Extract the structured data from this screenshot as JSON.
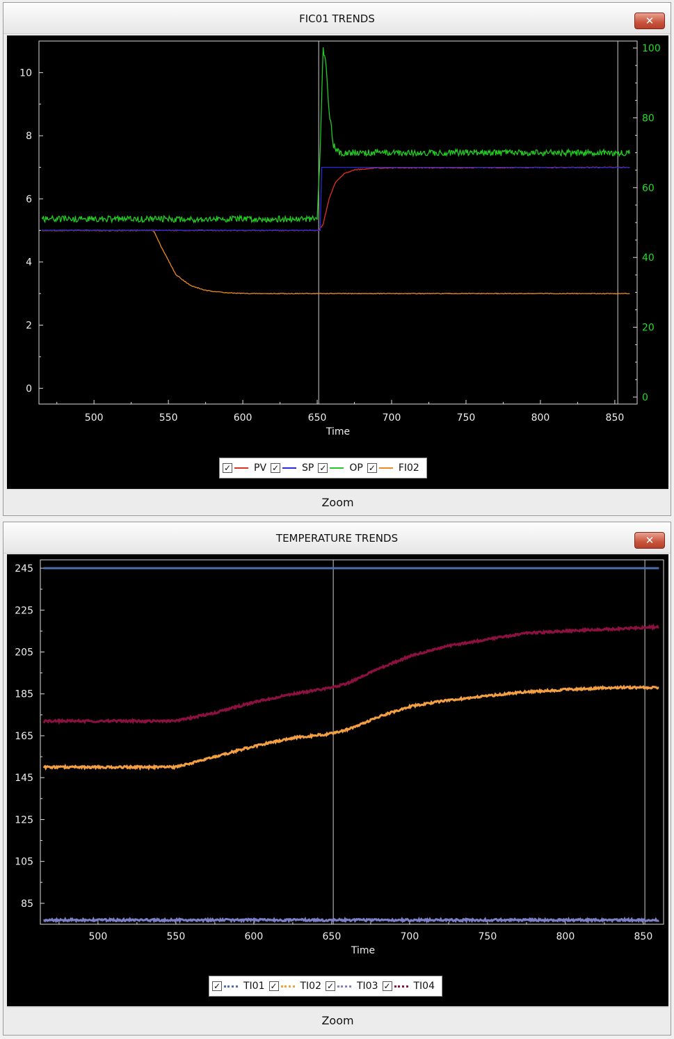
{
  "fic": {
    "title": "FIC01  TRENDS",
    "close_glyph": "✕",
    "xlabel": "Time",
    "left_ticks": [
      "0",
      "2",
      "4",
      "6",
      "8",
      "10"
    ],
    "right_ticks": [
      "0",
      "20",
      "40",
      "60",
      "80",
      "100"
    ],
    "x_ticks": [
      "500",
      "550",
      "600",
      "650",
      "700",
      "750",
      "800",
      "850"
    ],
    "legend": [
      {
        "label": "PV",
        "color": "#e0301e"
      },
      {
        "label": "SP",
        "color": "#2a2ae0"
      },
      {
        "label": "OP",
        "color": "#22cc22"
      },
      {
        "label": "FI02",
        "color": "#ee8822"
      }
    ],
    "right_axis_color": "#22dd22",
    "zoom_label": "Zoom"
  },
  "temp": {
    "title": "TEMPERATURE  TRENDS",
    "close_glyph": "✕",
    "xlabel": "Time",
    "left_ticks": [
      "85",
      "105",
      "125",
      "145",
      "165",
      "185",
      "205",
      "225",
      "245"
    ],
    "x_ticks": [
      "500",
      "550",
      "600",
      "650",
      "700",
      "750",
      "800",
      "850"
    ],
    "legend": [
      {
        "label": "TI01",
        "color": "#4a6fb0"
      },
      {
        "label": "TI02",
        "color": "#f5a040"
      },
      {
        "label": "TI03",
        "color": "#8080c8"
      },
      {
        "label": "TI04",
        "color": "#8c1040"
      }
    ],
    "zoom_label": "Zoom"
  },
  "chart_data": [
    {
      "type": "line",
      "title": "FIC01  TRENDS",
      "xlabel": "Time",
      "ylabel": "",
      "xlim": [
        463,
        865
      ],
      "ylim_left": [
        -0.5,
        11
      ],
      "ylim_right": [
        -2,
        102
      ],
      "cursor_x": [
        651,
        852
      ],
      "series": [
        {
          "name": "PV",
          "axis": "left",
          "x": [
            465,
            651,
            654,
            658,
            662,
            668,
            675,
            690,
            860
          ],
          "y": [
            5.0,
            5.0,
            5.2,
            6.0,
            6.5,
            6.8,
            6.92,
            6.98,
            7.0
          ]
        },
        {
          "name": "SP",
          "axis": "left",
          "x": [
            465,
            652,
            653,
            860
          ],
          "y": [
            5.0,
            5.0,
            7.0,
            7.0
          ]
        },
        {
          "name": "OP",
          "axis": "right",
          "x": [
            465,
            650,
            652,
            654,
            656,
            658,
            661,
            665,
            670,
            680,
            860
          ],
          "y": [
            51,
            51,
            70,
            100,
            95,
            82,
            72,
            70,
            70,
            70,
            70
          ]
        },
        {
          "name": "FI02",
          "axis": "left",
          "x": [
            465,
            540,
            545,
            555,
            565,
            575,
            590,
            605,
            860
          ],
          "y": [
            5.0,
            5.0,
            4.5,
            3.6,
            3.25,
            3.1,
            3.02,
            3.0,
            3.0
          ]
        }
      ],
      "legend_position": "bottom-center"
    },
    {
      "type": "line",
      "title": "TEMPERATURE  TRENDS",
      "xlabel": "Time",
      "ylabel": "",
      "xlim": [
        463,
        863
      ],
      "ylim": [
        75,
        249
      ],
      "cursor_x": [
        651,
        851
      ],
      "series": [
        {
          "name": "TI01",
          "x": [
            465,
            860
          ],
          "y": [
            245,
            245
          ]
        },
        {
          "name": "TI02",
          "x": [
            465,
            550,
            575,
            600,
            625,
            650,
            660,
            680,
            700,
            725,
            750,
            775,
            800,
            830,
            860
          ],
          "y": [
            150,
            150,
            155,
            160,
            164,
            166,
            168,
            174,
            179,
            182,
            184,
            186,
            187,
            188,
            188
          ]
        },
        {
          "name": "TI03",
          "x": [
            465,
            860
          ],
          "y": [
            77,
            77
          ]
        },
        {
          "name": "TI04",
          "x": [
            465,
            550,
            575,
            600,
            625,
            650,
            660,
            680,
            700,
            725,
            750,
            775,
            800,
            830,
            860
          ],
          "y": [
            172,
            172,
            176,
            181,
            185,
            188,
            190,
            197,
            203,
            208,
            211,
            214,
            215,
            216,
            217
          ]
        }
      ],
      "legend_position": "bottom-center"
    }
  ]
}
